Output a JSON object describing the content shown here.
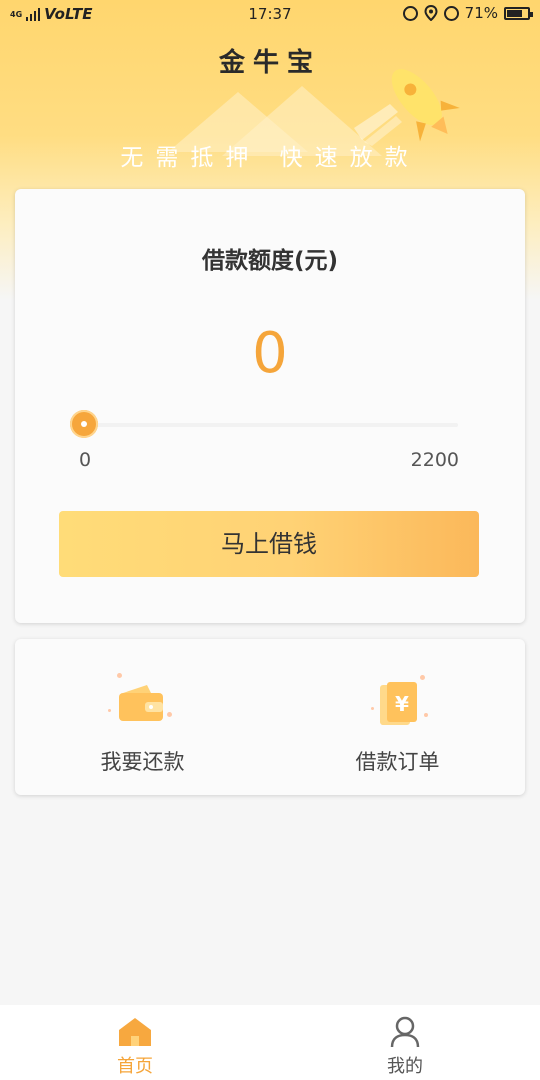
{
  "status_bar": {
    "network": "VoLTE",
    "network_small": "4G",
    "time": "17:37",
    "battery": "71%"
  },
  "header": {
    "title": "金牛宝",
    "slogan": "无需抵押  快速放款"
  },
  "loan_card": {
    "title": "借款额度(元)",
    "amount": "0",
    "slider": {
      "min_label": "0",
      "max_label": "2200",
      "value": 0,
      "min": 0,
      "max": 2200
    },
    "button_label": "马上借钱"
  },
  "actions": {
    "repay_label": "我要还款",
    "orders_label": "借款订单"
  },
  "tabbar": {
    "home_label": "首页",
    "mine_label": "我的"
  },
  "colors": {
    "accent": "#f5a53a",
    "header_yellow": "#ffd66e"
  }
}
